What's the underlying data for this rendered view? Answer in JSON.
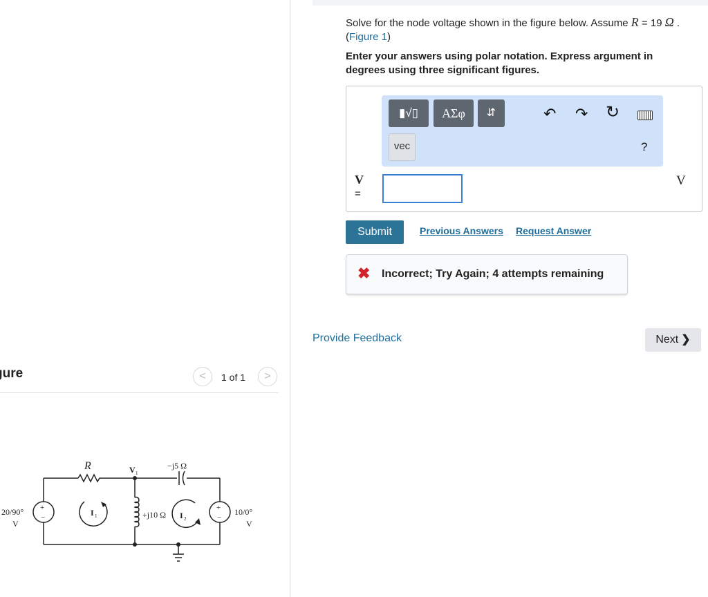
{
  "figure_pane": {
    "heading": "gure",
    "counter": "1 of 1",
    "prev_glyph": "<",
    "next_glyph": ">"
  },
  "circuit": {
    "resistor_label": "R",
    "node_label": "V",
    "node_sub": "1",
    "capacitor_label": "−j5 Ω",
    "inductor_label": "+j10 Ω",
    "mesh1_label": "I",
    "mesh1_sub": "1",
    "mesh2_label": "I",
    "mesh2_sub": "2",
    "source_left_value": "20/90°",
    "source_left_unit": "V",
    "source_right_value": "10/0°",
    "source_right_unit": "V",
    "plus": "+",
    "minus": "−"
  },
  "question": {
    "text_before": "Solve for the node voltage shown in the figure below. Assume ",
    "r_var": "R",
    "text_equals": " = 19 ",
    "omega": "Ω",
    "text_period": " .",
    "figure_link_open": "(",
    "figure_link": "Figure 1",
    "figure_link_close": ")",
    "instructions": "Enter your answers using polar notation. Express argument in degrees using three significant figures."
  },
  "toolbar": {
    "templates_label": "▮√▯",
    "greek_label": "ΑΣφ",
    "arrows_label": "⇵",
    "vec_label": "vec",
    "undo_glyph": "↶",
    "redo_glyph": "↷",
    "reset_glyph": "↻",
    "help_label": "?"
  },
  "answer": {
    "variable": "V",
    "equals": "=",
    "value": "",
    "unit": "V"
  },
  "actions": {
    "submit_label": "Submit",
    "previous_answers": "Previous Answers",
    "request_answer": "Request Answer"
  },
  "feedback": {
    "icon": "✖",
    "message": "Incorrect; Try Again; 4 attempts remaining"
  },
  "footer": {
    "provide_feedback": "Provide Feedback",
    "next_label": "Next",
    "next_chevron": "❯"
  },
  "colors": {
    "link": "#1f6d9a",
    "submit": "#2c7497",
    "toolbar_bg": "#cfe2fa",
    "error": "#d0232b",
    "input_focus": "#3b7fd6"
  }
}
